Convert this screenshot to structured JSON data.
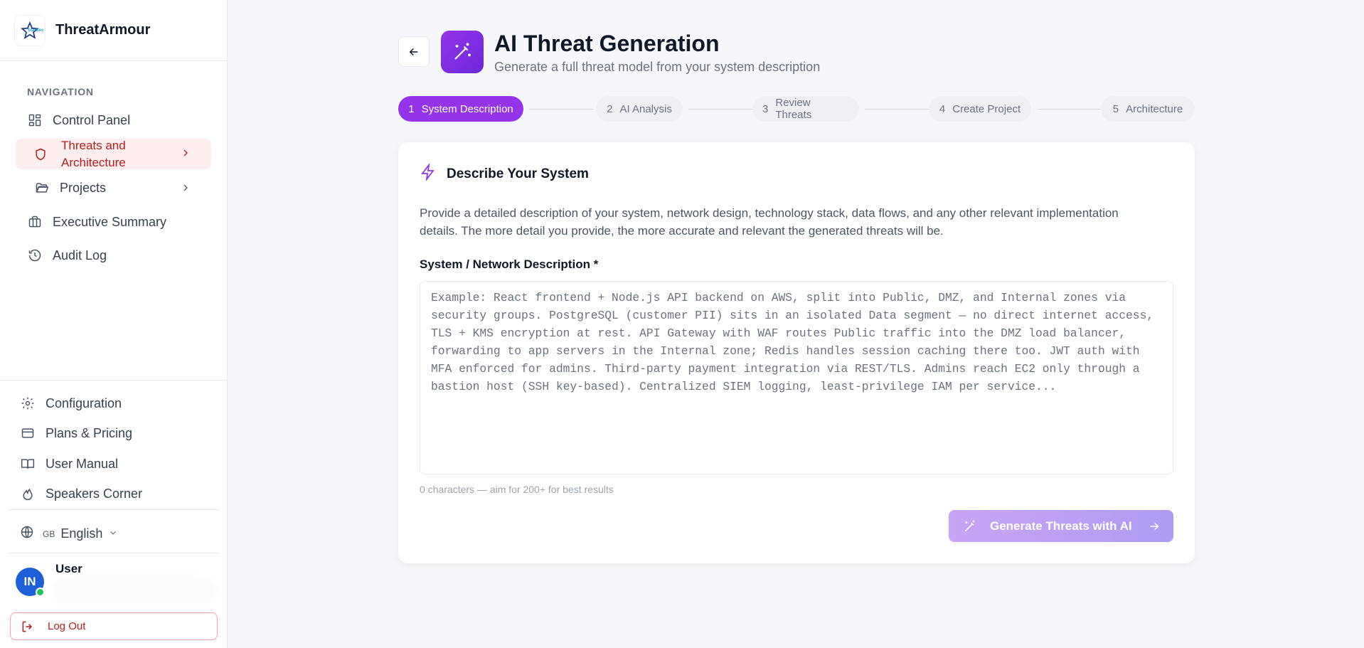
{
  "app": {
    "brand_name": "ThreatArmour",
    "logo_text": "StarSec"
  },
  "colors": {
    "accent": "#9333ea",
    "active_nav_bg": "#fdeff0",
    "active_nav_text": "#b91c1c",
    "avatar_bg": "#1d5fd6",
    "online": "#22c55e"
  },
  "sidebar": {
    "section_title": "NAVIGATION",
    "items": [
      {
        "label": "Control Panel",
        "icon": "dashboard-icon"
      },
      {
        "label": "Threats and Architecture",
        "icon": "shield-icon",
        "active": true
      },
      {
        "label": "Projects",
        "icon": "folder-open-icon"
      },
      {
        "label": "Executive Summary",
        "icon": "briefcase-icon"
      },
      {
        "label": "Audit Log",
        "icon": "history-icon"
      }
    ],
    "bottom_items": [
      {
        "label": "Configuration",
        "icon": "gear-icon"
      },
      {
        "label": "Plans & Pricing",
        "icon": "credit-card-icon"
      },
      {
        "label": "User Manual",
        "icon": "book-icon"
      },
      {
        "label": "Speakers Corner",
        "icon": "flame-icon"
      }
    ],
    "language": {
      "code": "GB",
      "name": "English"
    },
    "user": {
      "initials": "IN",
      "name": "User"
    },
    "logout_label": "Log Out"
  },
  "header": {
    "title": "AI Threat Generation",
    "subtitle": "Generate a full threat model from your system description"
  },
  "stepper": {
    "steps": [
      {
        "num": "1",
        "label": "System Description",
        "active": true
      },
      {
        "num": "2",
        "label": "AI Analysis"
      },
      {
        "num": "3",
        "label": "Review Threats"
      },
      {
        "num": "4",
        "label": "Create Project"
      },
      {
        "num": "5",
        "label": "Architecture"
      }
    ]
  },
  "card": {
    "title": "Describe Your System",
    "description": "Provide a detailed description of your system, network design, technology stack, data flows, and any other relevant implementation details. The more detail you provide, the more accurate and relevant the generated threats will be.",
    "field_label": "System / Network Description *",
    "textarea_value": "",
    "textarea_placeholder": "Example: React frontend + Node.js API backend on AWS, split into Public, DMZ, and Internal zones via security groups. PostgreSQL (customer PII) sits in an isolated Data segment — no direct internet access, TLS + KMS encryption at rest. API Gateway with WAF routes Public traffic into the DMZ load balancer, forwarding to app servers in the Internal zone; Redis handles session caching there too. JWT auth with MFA enforced for admins. Third-party payment integration via REST/TLS. Admins reach EC2 only through a bastion host (SSH key-based). Centralized SIEM logging, least-privilege IAM per service...",
    "char_count": "0 characters — aim for 200+ for best results",
    "generate_label": "Generate Threats with AI"
  }
}
